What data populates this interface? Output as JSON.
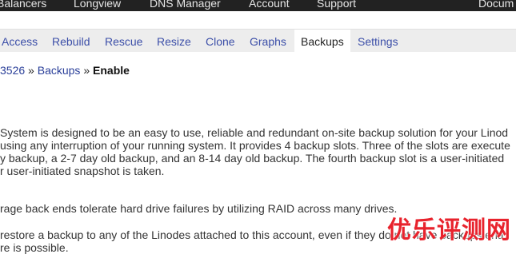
{
  "top_nav": {
    "items": [
      "Balancers",
      "Longview",
      "DNS Manager",
      "Account",
      "Support",
      "Docum"
    ]
  },
  "sub_nav": {
    "tabs": [
      "Access",
      "Rebuild",
      "Rescue",
      "Resize",
      "Clone",
      "Graphs",
      "Backups",
      "Settings"
    ],
    "active_tab": "Backups"
  },
  "breadcrumb": {
    "id_fragment": "3526",
    "sep1": " » ",
    "backups_link": "Backups",
    "sep2": " » ",
    "current": "Enable"
  },
  "content": {
    "intro_lines": [
      " System is designed to be an easy to use, reliable and redundant on-site backup solution for your Linod",
      "using any interruption of your running system. It provides 4 backup slots. Three of the slots are execute",
      "y backup, a 2-7 day old backup, and an 8-14 day old backup. The fourth backup slot is a user-initiated",
      "r user-initiated snapshot is taken."
    ],
    "storage_line": "rage back ends tolerate hard drive failures by utilizing RAID across many drives.",
    "restore_line": " restore a backup to any of the Linodes attached to this account, even if they do not have backups ena",
    "restore_line_2": "re is possible."
  },
  "watermark": {
    "text": "优乐评测网"
  },
  "colors": {
    "top_nav_bg": "#222222",
    "sub_nav_bg": "#ededed",
    "link": "#3b4ea8",
    "watermark": "#e8232d"
  }
}
